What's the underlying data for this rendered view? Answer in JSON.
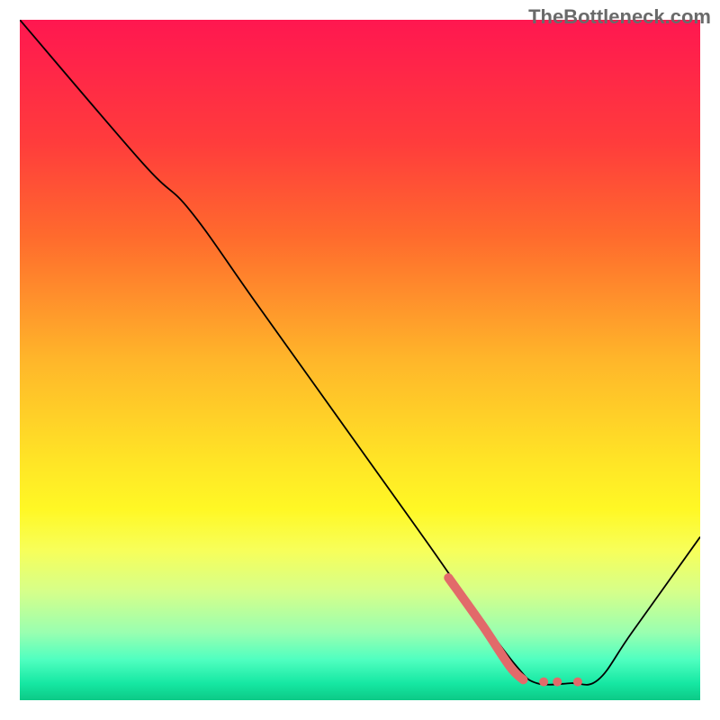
{
  "watermark": "TheBottleneck.com",
  "chart_data": {
    "type": "line",
    "title": "",
    "xlabel": "",
    "ylabel": "",
    "xlim": [
      0,
      100
    ],
    "ylim": [
      0,
      100
    ],
    "gradient_stops": [
      {
        "offset": 0.0,
        "color": "#ff1750"
      },
      {
        "offset": 0.18,
        "color": "#ff3c3c"
      },
      {
        "offset": 0.32,
        "color": "#ff6b2d"
      },
      {
        "offset": 0.5,
        "color": "#ffb62a"
      },
      {
        "offset": 0.65,
        "color": "#ffe526"
      },
      {
        "offset": 0.72,
        "color": "#fff825"
      },
      {
        "offset": 0.78,
        "color": "#f7ff5a"
      },
      {
        "offset": 0.84,
        "color": "#d6ff8a"
      },
      {
        "offset": 0.9,
        "color": "#9affb0"
      },
      {
        "offset": 0.94,
        "color": "#50ffc0"
      },
      {
        "offset": 0.975,
        "color": "#16e8a3"
      },
      {
        "offset": 1.0,
        "color": "#0cc986"
      }
    ],
    "series": [
      {
        "name": "main-line",
        "style": {
          "stroke": "#000000",
          "width": 1.8
        },
        "points": [
          {
            "x": 0,
            "y": 100
          },
          {
            "x": 18,
            "y": 79
          },
          {
            "x": 25,
            "y": 72
          },
          {
            "x": 35,
            "y": 58
          },
          {
            "x": 50,
            "y": 37
          },
          {
            "x": 60,
            "y": 23
          },
          {
            "x": 67,
            "y": 13
          },
          {
            "x": 73,
            "y": 5
          },
          {
            "x": 76,
            "y": 2.5
          },
          {
            "x": 81,
            "y": 2.5
          },
          {
            "x": 85,
            "y": 3
          },
          {
            "x": 90,
            "y": 10
          },
          {
            "x": 100,
            "y": 24
          }
        ]
      },
      {
        "name": "highlight-segment",
        "style": {
          "stroke": "#e26a6a",
          "width": 10,
          "linecap": "round"
        },
        "points": [
          {
            "x": 63,
            "y": 18
          },
          {
            "x": 68,
            "y": 11
          },
          {
            "x": 72,
            "y": 5
          },
          {
            "x": 74,
            "y": 3
          }
        ]
      }
    ],
    "highlight_dots": {
      "style": {
        "fill": "#e26a6a",
        "radius": 5
      },
      "points": [
        {
          "x": 77,
          "y": 2.7
        },
        {
          "x": 79,
          "y": 2.7
        },
        {
          "x": 82,
          "y": 2.7
        }
      ]
    }
  }
}
